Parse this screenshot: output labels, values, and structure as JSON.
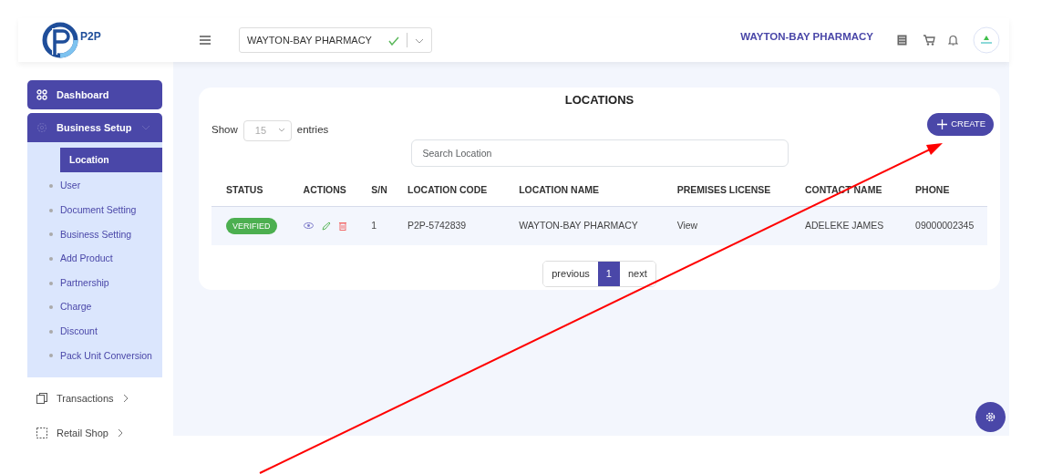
{
  "logo": {
    "text": "P2P"
  },
  "header": {
    "store_select": {
      "value": "WAYTON-BAY PHARMACY",
      "valid": true
    },
    "store_name": "WAYTON-BAY PHARMACY"
  },
  "sidebar": {
    "items": [
      {
        "label": "Dashboard",
        "kind": "link",
        "selected": true
      },
      {
        "label": "Business Setup",
        "kind": "group",
        "selected": true,
        "expanded": true,
        "children": [
          {
            "label": "Location",
            "selected": true
          },
          {
            "label": "User",
            "selected": false
          },
          {
            "label": "Document Setting",
            "selected": false
          },
          {
            "label": "Business Setting",
            "selected": false
          },
          {
            "label": "Add Product",
            "selected": false
          },
          {
            "label": "Partnership",
            "selected": false
          },
          {
            "label": "Charge",
            "selected": false
          },
          {
            "label": "Discount",
            "selected": false
          },
          {
            "label": "Pack Unit Conversion",
            "selected": false
          }
        ]
      },
      {
        "label": "Transactions",
        "kind": "group",
        "selected": false,
        "expanded": false
      },
      {
        "label": "Retail Shop",
        "kind": "group",
        "selected": false,
        "expanded": false
      }
    ]
  },
  "page": {
    "title": "LOCATIONS",
    "length": {
      "before": "Show",
      "value": "15",
      "after": "entries"
    },
    "search": {
      "placeholder": "Search Location"
    },
    "create_button": "CREATE",
    "table": {
      "columns": [
        "STATUS",
        "ACTIONS",
        "S/N",
        "LOCATION CODE",
        "LOCATION NAME",
        "PREMISES LICENSE",
        "CONTACT NAME",
        "PHONE"
      ],
      "rows": [
        {
          "status": "VERIFIED",
          "sn": "1",
          "code": "P2P-5742839",
          "name": "WAYTON-BAY PHARMACY",
          "license": "View",
          "contact": "ADELEKE JAMES",
          "phone": "09000002345"
        }
      ]
    },
    "pagination": {
      "previous": "previous",
      "pages": [
        {
          "label": "1",
          "selected": true
        }
      ],
      "next": "next"
    }
  }
}
